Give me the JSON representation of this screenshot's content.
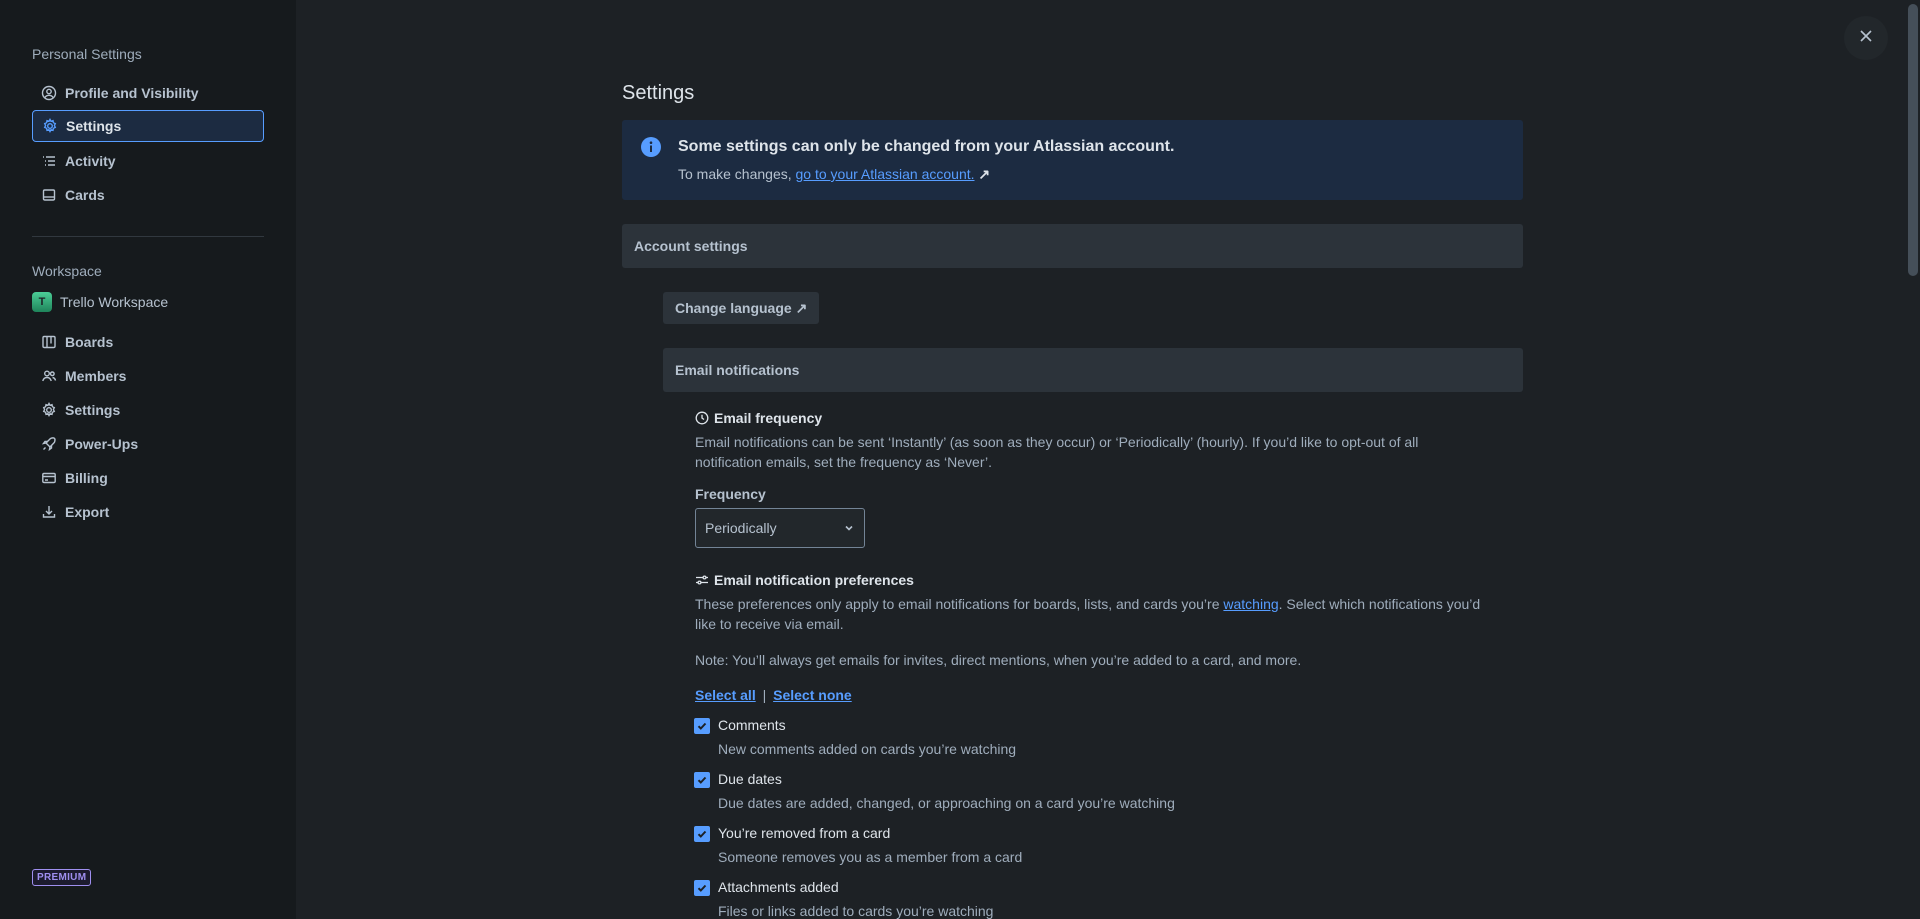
{
  "sidebar": {
    "personal_heading": "Personal Settings",
    "personal_items": [
      {
        "label": "Profile and Visibility",
        "icon": "profile-icon"
      },
      {
        "label": "Settings",
        "icon": "gear-icon",
        "active": true
      },
      {
        "label": "Activity",
        "icon": "activity-list-icon"
      },
      {
        "label": "Cards",
        "icon": "card-icon"
      }
    ],
    "workspace_heading": "Workspace",
    "workspace_name": "Trello Workspace",
    "workspace_avatar": "T",
    "workspace_items": [
      {
        "label": "Boards",
        "icon": "boards-icon"
      },
      {
        "label": "Members",
        "icon": "members-icon"
      },
      {
        "label": "Settings",
        "icon": "gear-icon"
      },
      {
        "label": "Power-Ups",
        "icon": "rocket-icon"
      },
      {
        "label": "Billing",
        "icon": "billing-icon"
      },
      {
        "label": "Export",
        "icon": "export-icon"
      }
    ],
    "premium_badge": "PREMIUM"
  },
  "main": {
    "title": "Settings",
    "banner": {
      "title": "Some settings can only be changed from your Atlassian account.",
      "text_prefix": "To make changes, ",
      "link": "go to your Atlassian account.",
      "link_arrow": "↗"
    },
    "account_settings_heading": "Account settings",
    "change_language_button": "Change language ↗",
    "email_notifications_heading": "Email notifications",
    "email_frequency": {
      "heading": "Email frequency",
      "line1": "Email notifications can be sent ‘Instantly’ (as soon as they occur) or ‘Periodically’ (hourly). If you’d like to opt-out of all",
      "line2": "notification emails, set the frequency as ‘Never’.",
      "frequency_label": "Frequency",
      "frequency_value": "Periodically"
    },
    "preferences": {
      "heading": "Email notification preferences",
      "line1_prefix": "These preferences only apply to email notifications for boards, lists, and cards you’re ",
      "line1_link": "watching",
      "line1_suffix": ". Select which notifications you’d",
      "line2": "like to receive via email.",
      "note": "Note: You’ll always get emails for invites, direct mentions, when you’re added to a card, and more.",
      "select_all": "Select all",
      "separator": "|",
      "select_none": "Select none",
      "items": [
        {
          "title": "Comments",
          "desc": "New comments added on cards you’re watching",
          "checked": true
        },
        {
          "title": "Due dates",
          "desc": "Due dates are added, changed, or approaching on a card you’re watching",
          "checked": true
        },
        {
          "title": "You’re removed from a card",
          "desc": "Someone removes you as a member from a card",
          "checked": true
        },
        {
          "title": "Attachments added",
          "desc": "Files or links added to cards you’re watching",
          "checked": true
        }
      ]
    }
  },
  "colors": {
    "accent": "#579dff",
    "background": "#1d2125",
    "sidebar_bg": "#161a1d",
    "banner_bg": "#1c2b41",
    "premium": "#9f8fef"
  }
}
